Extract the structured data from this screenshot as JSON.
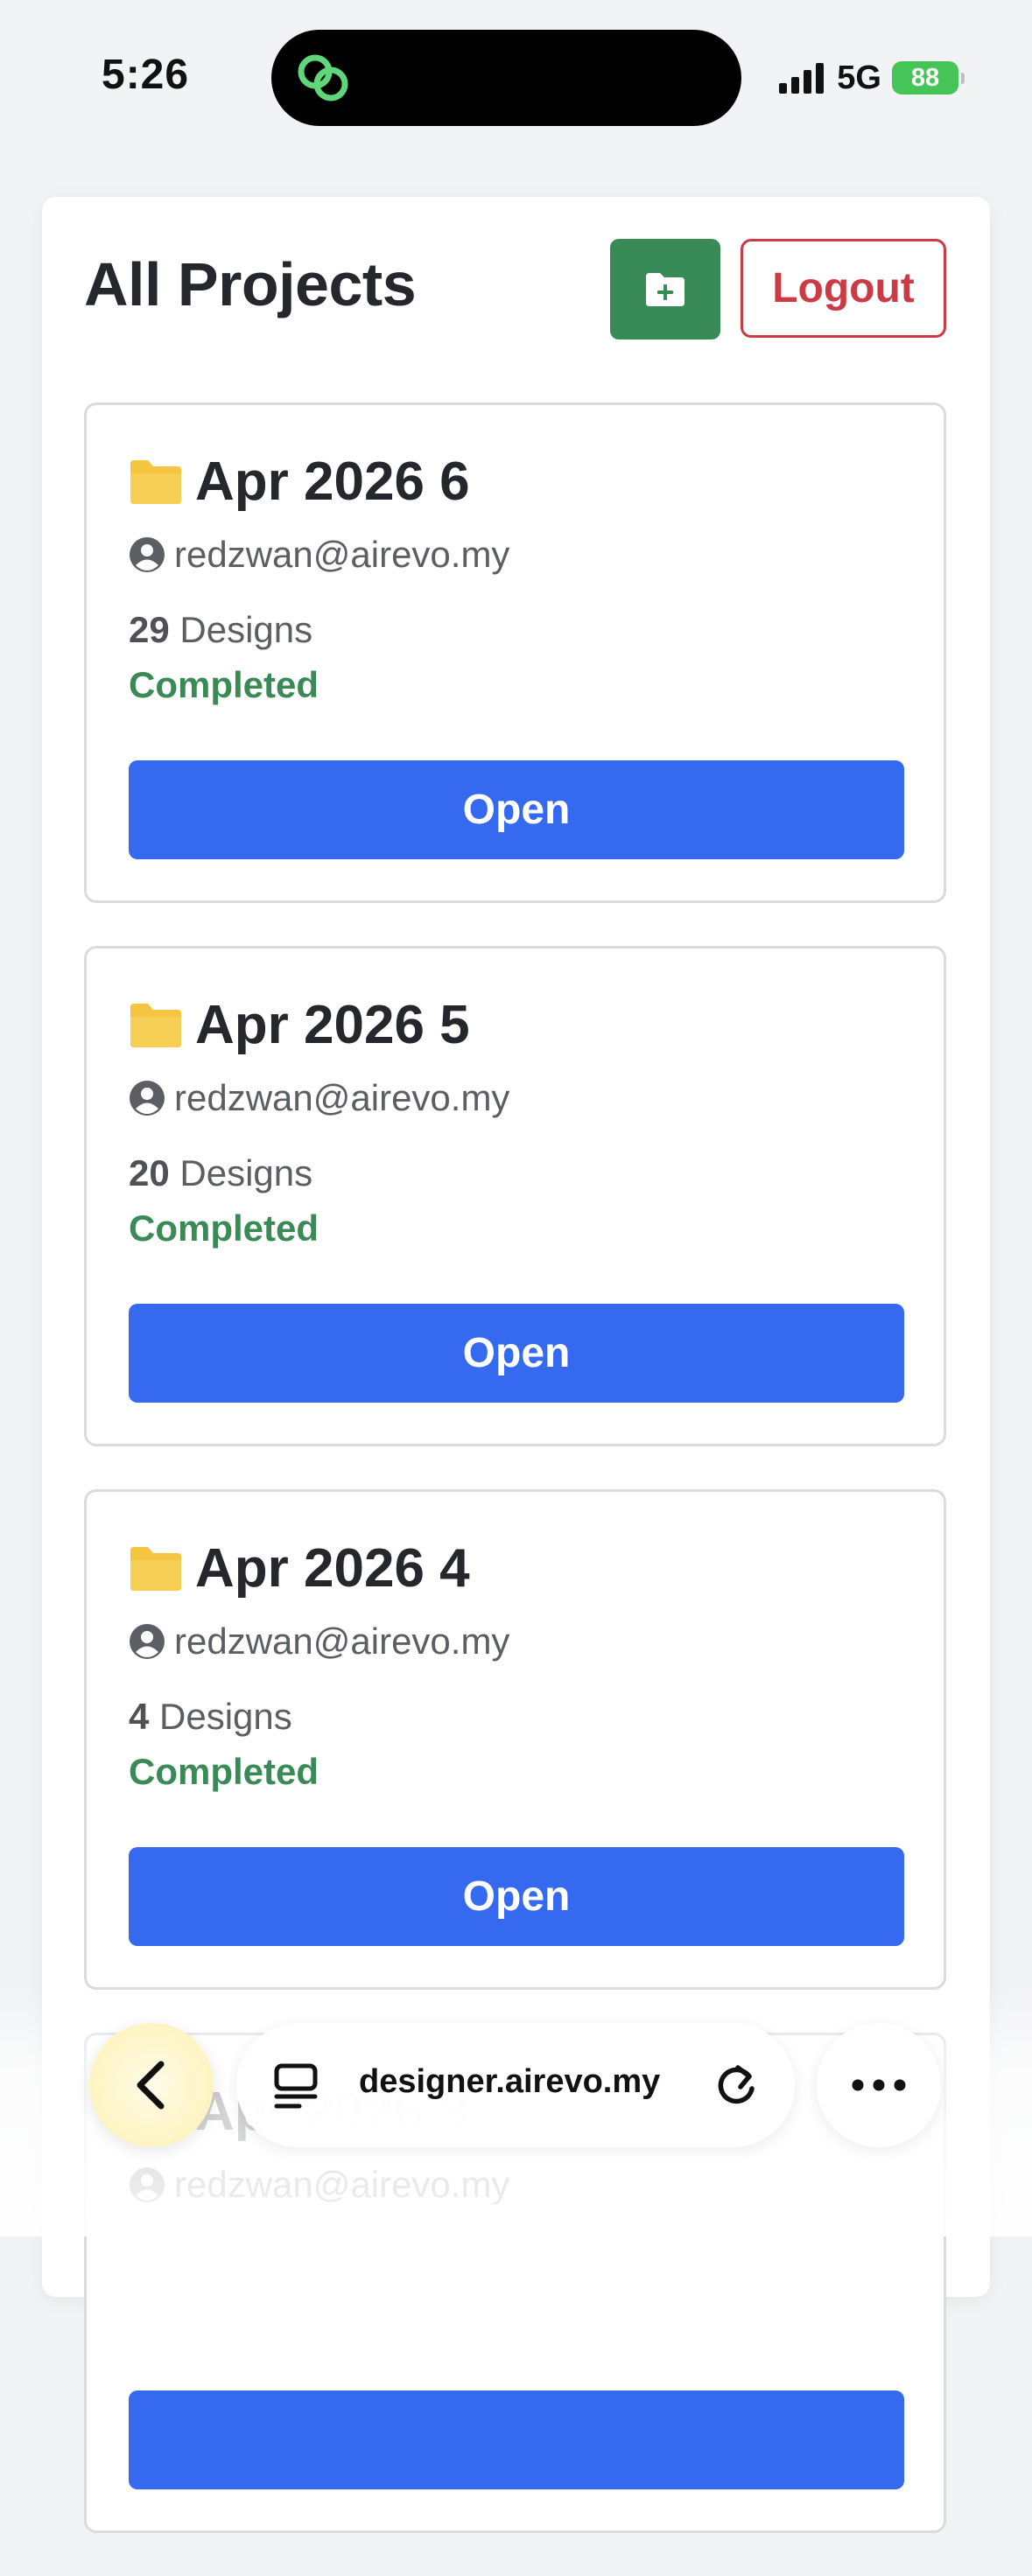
{
  "status_bar": {
    "time": "5:26",
    "network": "5G",
    "battery": "88",
    "battery_color": "#45c557",
    "island_icon": "link-icon",
    "signal_icon": "cellular-signal-icon"
  },
  "header": {
    "title": "All Projects",
    "new_project_icon": "folder-plus-icon",
    "logout_label": "Logout"
  },
  "colors": {
    "new_project_button": "#388a56",
    "logout": "#cc3b45",
    "open_button": "#356af0",
    "status_completed": "#3a8a56",
    "folder": "#f5c542"
  },
  "projects": [
    {
      "name": "Apr 2026 6",
      "owner": "redzwan@airevo.my",
      "designs_count": "29",
      "designs_label": "Designs",
      "status": "Completed",
      "open_label": "Open"
    },
    {
      "name": "Apr 2026 5",
      "owner": "redzwan@airevo.my",
      "designs_count": "20",
      "designs_label": "Designs",
      "status": "Completed",
      "open_label": "Open"
    },
    {
      "name": "Apr 2026 4",
      "owner": "redzwan@airevo.my",
      "designs_count": "4",
      "designs_label": "Designs",
      "status": "Completed",
      "open_label": "Open"
    },
    {
      "name": "Apr 2026 3",
      "owner": "redzwan@airevo.my",
      "designs_count": "",
      "designs_label": "",
      "status": "",
      "open_label": ""
    }
  ],
  "browser_bar": {
    "url": "designer.airevo.my",
    "back_icon": "chevron-left-icon",
    "tabs_icon": "tabs-icon",
    "reload_icon": "reload-icon",
    "more_icon": "more-horizontal-icon"
  }
}
